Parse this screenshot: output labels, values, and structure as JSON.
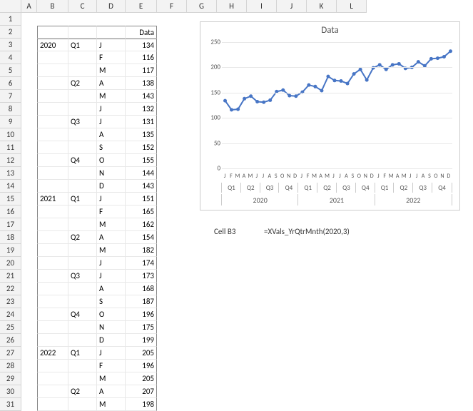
{
  "columns": [
    "A",
    "B",
    "C",
    "D",
    "E",
    "F",
    "G",
    "H",
    "I",
    "J",
    "K",
    "L"
  ],
  "chart_data": {
    "type": "line",
    "title": "Data",
    "ylabel": "",
    "xlabel": "",
    "ylim": [
      0,
      250
    ],
    "yticks": [
      0,
      50,
      100,
      150,
      200,
      250
    ],
    "categories_months": [
      "J",
      "F",
      "M",
      "A",
      "M",
      "J",
      "J",
      "A",
      "S",
      "O",
      "N",
      "D",
      "J",
      "F",
      "M",
      "A",
      "M",
      "J",
      "J",
      "A",
      "S",
      "O",
      "N",
      "D",
      "J",
      "F",
      "M",
      "A",
      "M",
      "J",
      "J",
      "A",
      "S",
      "O",
      "N",
      "D"
    ],
    "categories_quarters": [
      "Q1",
      "Q2",
      "Q3",
      "Q4",
      "Q1",
      "Q2",
      "Q3",
      "Q4",
      "Q1",
      "Q2",
      "Q3",
      "Q4"
    ],
    "categories_years": [
      "2020",
      "2021",
      "2022"
    ],
    "values": [
      134,
      116,
      117,
      138,
      143,
      132,
      131,
      135,
      152,
      155,
      144,
      143,
      151,
      165,
      162,
      154,
      182,
      174,
      173,
      168,
      187,
      196,
      175,
      199,
      205,
      196,
      205,
      207,
      198,
      200,
      211,
      203,
      217,
      218,
      221,
      232
    ]
  },
  "table": {
    "header_data": "Data",
    "rows": [
      {
        "yr": "2020",
        "q": "Q1",
        "m": "J",
        "v": 134
      },
      {
        "yr": "",
        "q": "",
        "m": "F",
        "v": 116
      },
      {
        "yr": "",
        "q": "",
        "m": "M",
        "v": 117
      },
      {
        "yr": "",
        "q": "Q2",
        "m": "A",
        "v": 138
      },
      {
        "yr": "",
        "q": "",
        "m": "M",
        "v": 143
      },
      {
        "yr": "",
        "q": "",
        "m": "J",
        "v": 132
      },
      {
        "yr": "",
        "q": "Q3",
        "m": "J",
        "v": 131
      },
      {
        "yr": "",
        "q": "",
        "m": "A",
        "v": 135
      },
      {
        "yr": "",
        "q": "",
        "m": "S",
        "v": 152
      },
      {
        "yr": "",
        "q": "Q4",
        "m": "O",
        "v": 155
      },
      {
        "yr": "",
        "q": "",
        "m": "N",
        "v": 144
      },
      {
        "yr": "",
        "q": "",
        "m": "D",
        "v": 143
      },
      {
        "yr": "2021",
        "q": "Q1",
        "m": "J",
        "v": 151
      },
      {
        "yr": "",
        "q": "",
        "m": "F",
        "v": 165
      },
      {
        "yr": "",
        "q": "",
        "m": "M",
        "v": 162
      },
      {
        "yr": "",
        "q": "Q2",
        "m": "A",
        "v": 154
      },
      {
        "yr": "",
        "q": "",
        "m": "M",
        "v": 182
      },
      {
        "yr": "",
        "q": "",
        "m": "J",
        "v": 174
      },
      {
        "yr": "",
        "q": "Q3",
        "m": "J",
        "v": 173
      },
      {
        "yr": "",
        "q": "",
        "m": "A",
        "v": 168
      },
      {
        "yr": "",
        "q": "",
        "m": "S",
        "v": 187
      },
      {
        "yr": "",
        "q": "Q4",
        "m": "O",
        "v": 196
      },
      {
        "yr": "",
        "q": "",
        "m": "N",
        "v": 175
      },
      {
        "yr": "",
        "q": "",
        "m": "D",
        "v": 199
      },
      {
        "yr": "2022",
        "q": "Q1",
        "m": "J",
        "v": 205
      },
      {
        "yr": "",
        "q": "",
        "m": "F",
        "v": 196
      },
      {
        "yr": "",
        "q": "",
        "m": "M",
        "v": 205
      },
      {
        "yr": "",
        "q": "Q2",
        "m": "A",
        "v": 207
      },
      {
        "yr": "",
        "q": "",
        "m": "M",
        "v": 198
      }
    ]
  },
  "info": {
    "cell_label": "Cell B3",
    "formula": "=XVals_YrQtrMnth(2020,3)"
  }
}
